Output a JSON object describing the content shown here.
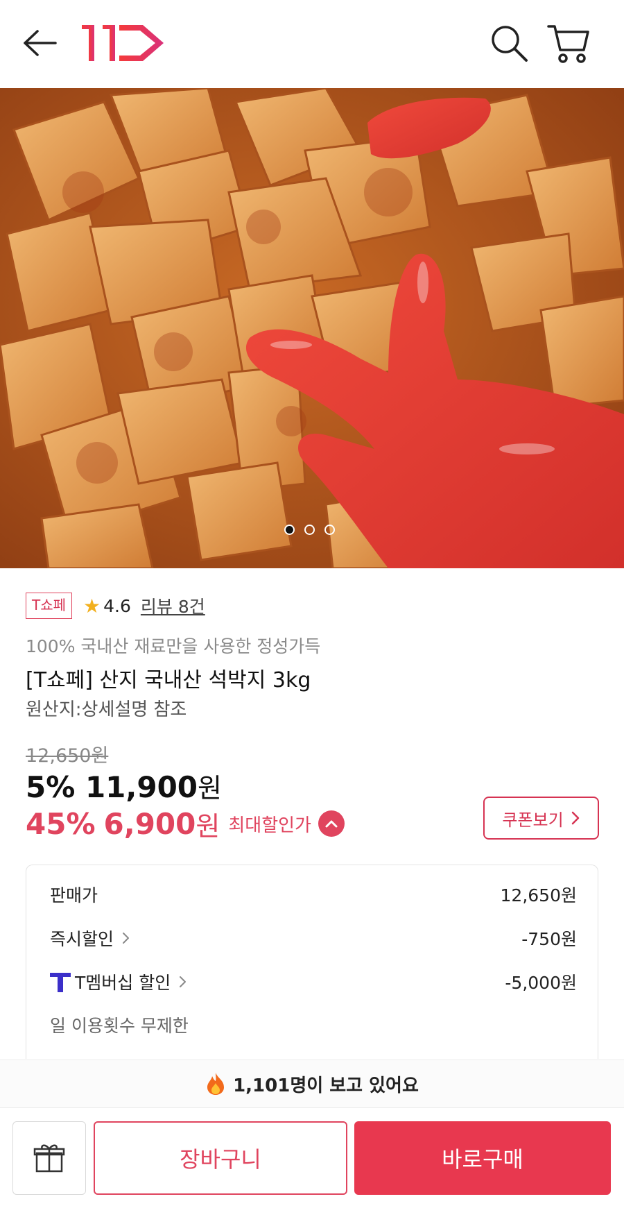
{
  "header": {
    "back_icon": "arrow-left-icon",
    "logo_text": "11",
    "search_icon": "search-icon",
    "cart_icon": "cart-icon"
  },
  "hero": {
    "image_subject": "seasoned radish kimchi photo",
    "carousel_count": 3,
    "carousel_active": 1
  },
  "product": {
    "tag": "T쇼페",
    "rating": "4.6",
    "review_link": "리뷰 8건",
    "subtitle": "100% 국내산 재료만을 사용한 정성가득",
    "title": "[T쇼페] 산지 국내산 석박지 3kg",
    "origin": "원산지:상세설명 참조"
  },
  "pricing": {
    "original_price": "12,650원",
    "sale_percent": "5%",
    "sale_price": "11,900",
    "sale_won": "원",
    "max_percent": "45%",
    "max_price": "6,900",
    "max_won": "원",
    "max_label": "최대할인가",
    "coupon_button": "쿠폰보기"
  },
  "price_detail": {
    "rows": [
      {
        "label": "판매가",
        "value": "12,650원"
      },
      {
        "label": "즉시할인",
        "value": "-750원"
      },
      {
        "label": "T멤버십 할인",
        "value": "-5,000원"
      }
    ],
    "membership_note": "일 이용횟수 무제한"
  },
  "watching": {
    "icon": "fire-icon",
    "text": "1,101명이 보고 있어요"
  },
  "actions": {
    "gift_icon": "gift-icon",
    "add_to_cart": "장바구니",
    "buy_now": "바로구매"
  },
  "colors": {
    "brand_red": "#e0445e",
    "buy_button": "#e8384f",
    "star": "#f2b01e"
  }
}
